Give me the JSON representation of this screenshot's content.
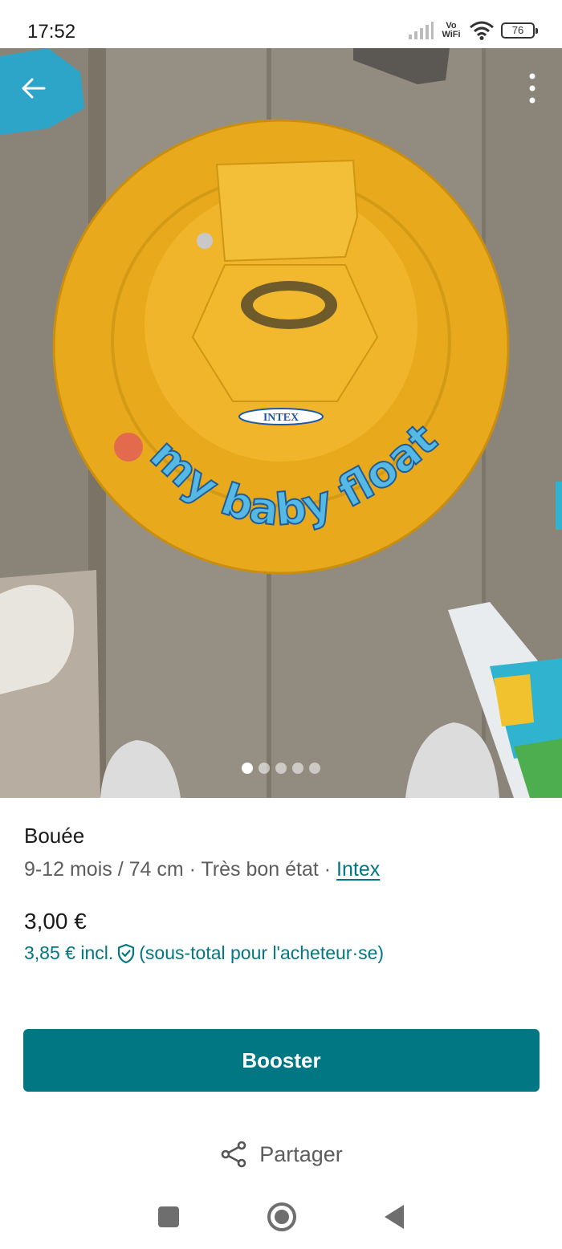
{
  "status_bar": {
    "time": "17:52",
    "vowifi_line1": "Vo",
    "vowifi_line2": "WiFi",
    "battery": "76"
  },
  "photo": {
    "float_text": "my baby float",
    "logo_text": "INTEX",
    "page_count": 5,
    "active_page": 1
  },
  "item": {
    "title": "Bouée",
    "details": "9-12 mois / 74 cm · Très bon état · ",
    "brand": "Intex",
    "price": "3,00 €",
    "price_incl": "3,85 € incl.",
    "price_incl_note": "(sous-total pour l'acheteur·se)"
  },
  "actions": {
    "booster_label": "Booster",
    "share_label": "Partager"
  },
  "colors": {
    "accent": "#007782",
    "float": "#e8a91c",
    "floor": "#8c8579"
  },
  "icons": {
    "back": "back-arrow-icon",
    "more": "more-vertical-icon",
    "shield": "shield-check-icon",
    "share": "share-icon",
    "nav_recents": "nav-square-icon",
    "nav_home": "nav-home-icon",
    "nav_back": "nav-back-icon"
  }
}
